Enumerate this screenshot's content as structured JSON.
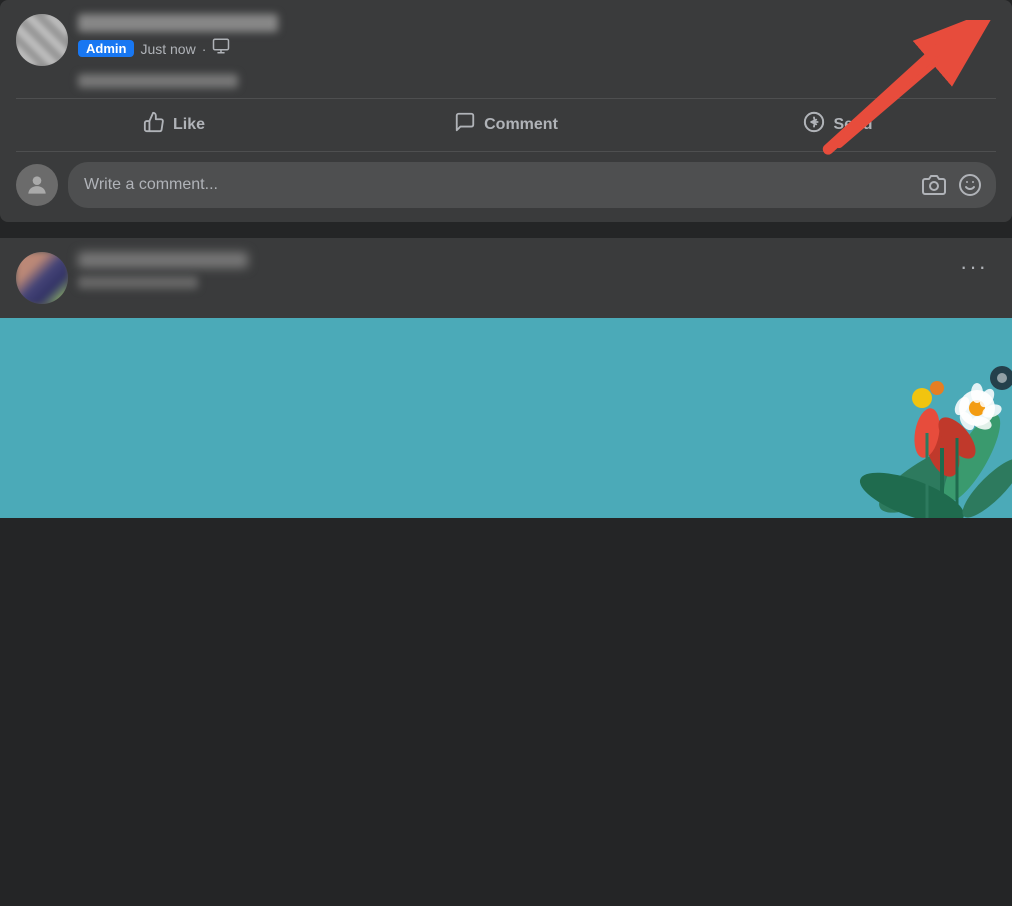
{
  "post1": {
    "admin_badge": "Admin",
    "time": "Just now",
    "more_options_label": "···",
    "actions": {
      "like": "Like",
      "comment": "Comment",
      "send": "Send"
    },
    "comment_placeholder": "Write a comment..."
  },
  "post2": {
    "more_options_label": "···"
  },
  "icons": {
    "like": "👍",
    "comment": "💬",
    "send": "🔵",
    "camera": "📷",
    "emoji": "🙂",
    "privacy": "⊞",
    "dots": "•••"
  }
}
